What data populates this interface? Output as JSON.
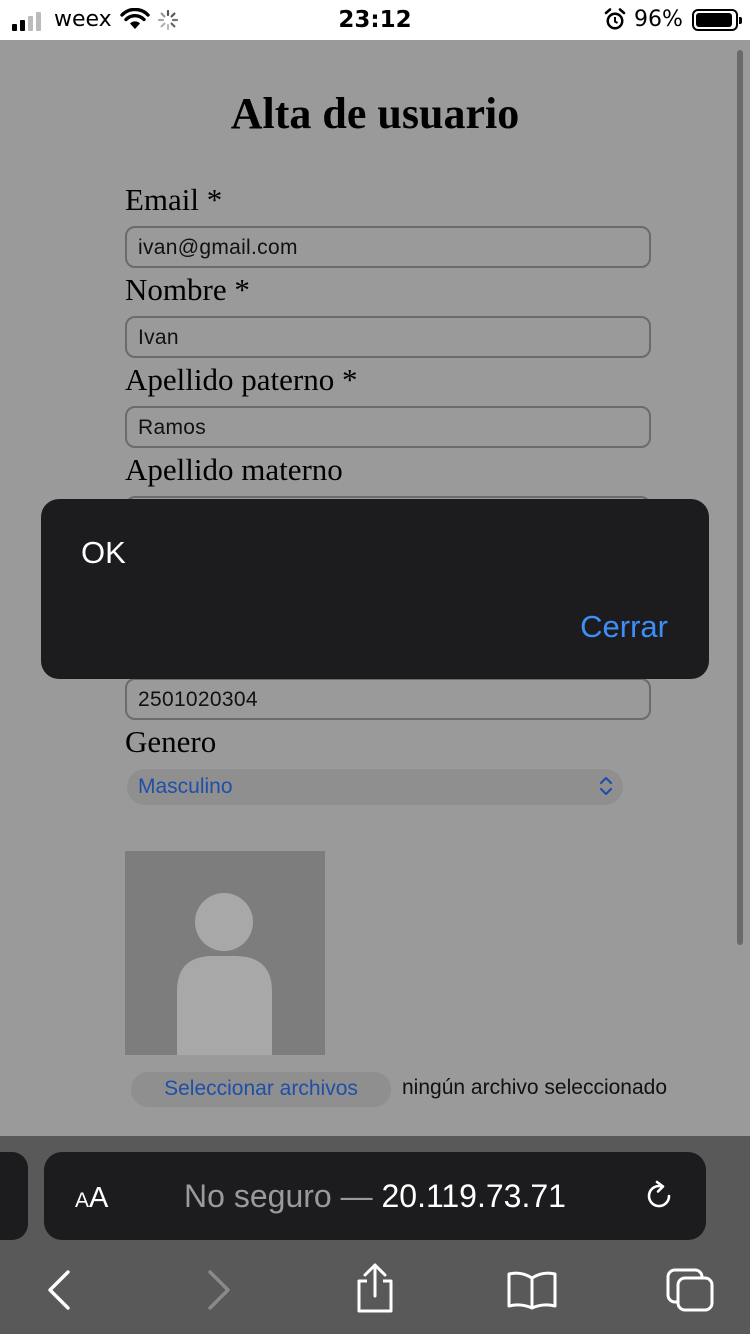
{
  "status_bar": {
    "carrier": "weex",
    "time": "23:12",
    "battery_percent_label": "96%",
    "battery_level": 0.96
  },
  "page": {
    "title": "Alta de usuario",
    "fields": {
      "email_label": "Email *",
      "email_value": "ivan@gmail.com",
      "nombre_label": "Nombre *",
      "nombre_value": "Ivan",
      "apellido_paterno_label": "Apellido paterno *",
      "apellido_paterno_value": "Ramos",
      "apellido_materno_label": "Apellido materno",
      "telefono_value": "2501020304",
      "genero_label": "Genero",
      "genero_selected": "Masculino"
    },
    "file_input": {
      "button_label": "Seleccionar archivos",
      "status": "ningún archivo seleccionado"
    }
  },
  "alert": {
    "message": "OK",
    "close_label": "Cerrar"
  },
  "safari": {
    "text_size_label_big": "A",
    "text_size_label_small": "A",
    "url_prefix": "No seguro — ",
    "url_host": "20.119.73.71"
  },
  "colors": {
    "link_blue": "#3d8ef7",
    "alert_bg": "#1c1c1e",
    "page_dimmed_bg": "#9a9a9a"
  }
}
